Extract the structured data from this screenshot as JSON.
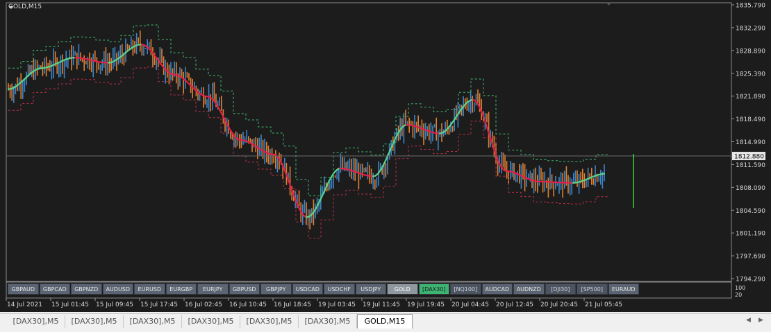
{
  "window": {
    "title": "GOLD,M15"
  },
  "price_axis": {
    "labels": [
      "1835.790",
      "1832.290",
      "1828.890",
      "1825.390",
      "1821.890",
      "1818.490",
      "1814.990",
      "1811.590",
      "1808.090",
      "1804.590",
      "1801.190",
      "1797.690",
      "1794.290"
    ],
    "current_price": "1812.880"
  },
  "indicator_axis": {
    "labels": [
      "100",
      "20"
    ]
  },
  "time_axis": {
    "labels": [
      "14 Jul 2021",
      "15 Jul 01:45",
      "15 Jul 09:45",
      "15 Jul 17:45",
      "16 Jul 02:45",
      "16 Jul 10:45",
      "16 Jul 18:45",
      "19 Jul 03:45",
      "19 Jul 11:45",
      "19 Jul 19:45",
      "20 Jul 04:45",
      "20 Jul 12:45",
      "20 Jul 20:45",
      "21 Jul 05:45"
    ]
  },
  "symbol_buttons": [
    {
      "label": "GBPAUD",
      "state": "normal"
    },
    {
      "label": "GBPCAD",
      "state": "normal"
    },
    {
      "label": "GBPNZD",
      "state": "normal"
    },
    {
      "label": "AUDUSD",
      "state": "normal"
    },
    {
      "label": "EURUSD",
      "state": "normal"
    },
    {
      "label": "EURGBP",
      "state": "normal"
    },
    {
      "label": "EURJPY",
      "state": "normal"
    },
    {
      "label": "GBPUSD",
      "state": "normal"
    },
    {
      "label": "GBPJPY",
      "state": "normal"
    },
    {
      "label": "USDCAD",
      "state": "normal"
    },
    {
      "label": "USDCHF",
      "state": "normal"
    },
    {
      "label": "USDJPY",
      "state": "normal"
    },
    {
      "label": "GOLD",
      "state": "gray"
    },
    {
      "label": "[DAX30]",
      "state": "green"
    },
    {
      "label": "[NQ100]",
      "state": "bracket"
    },
    {
      "label": "AUDCAD",
      "state": "normal"
    },
    {
      "label": "AUDNZD",
      "state": "normal"
    },
    {
      "label": "[DJI30]",
      "state": "bracket"
    },
    {
      "label": "[SP500]",
      "state": "bracket"
    },
    {
      "label": "EURAUD",
      "state": "normal"
    }
  ],
  "tabs": [
    {
      "label": "[DAX30],M5",
      "active": false
    },
    {
      "label": "[DAX30],M5",
      "active": false
    },
    {
      "label": "[DAX30],M5",
      "active": false
    },
    {
      "label": "[DAX30],M5",
      "active": false
    },
    {
      "label": "[DAX30],M5",
      "active": false
    },
    {
      "label": "[DAX30],M5",
      "active": false
    },
    {
      "label": "GOLD,M15",
      "active": true
    }
  ],
  "chart_data": {
    "type": "line",
    "title": "GOLD,M15",
    "ylim": [
      1794.29,
      1835.79
    ],
    "x": [
      "14 Jul 2021",
      "15 Jul 01:45",
      "15 Jul 09:45",
      "15 Jul 17:45",
      "16 Jul 02:45",
      "16 Jul 10:45",
      "16 Jul 18:45",
      "19 Jul 03:45",
      "19 Jul 11:45",
      "19 Jul 19:45",
      "20 Jul 04:45",
      "20 Jul 12:45",
      "20 Jul 20:45",
      "21 Jul 05:45"
    ],
    "series": [
      {
        "values": [
          1823.0,
          1826.2,
          1827.8,
          1827.0,
          1829.8,
          1825.2,
          1821.9,
          1815.3,
          1813.1,
          1803.6,
          1811.0,
          1809.8,
          1817.6,
          1816.3,
          1821.4,
          1810.6,
          1809.0,
          1808.8,
          1810.2
        ]
      }
    ],
    "colors": {
      "background": "#1c1c1c",
      "bull": "#3d85c6",
      "bear": "#e08030",
      "smooth_up": "#5cd38a",
      "smooth_down": "#e0204a",
      "current_price_line": "#6a6a6a",
      "current_bar": "#3cd03c"
    },
    "grid": false
  }
}
